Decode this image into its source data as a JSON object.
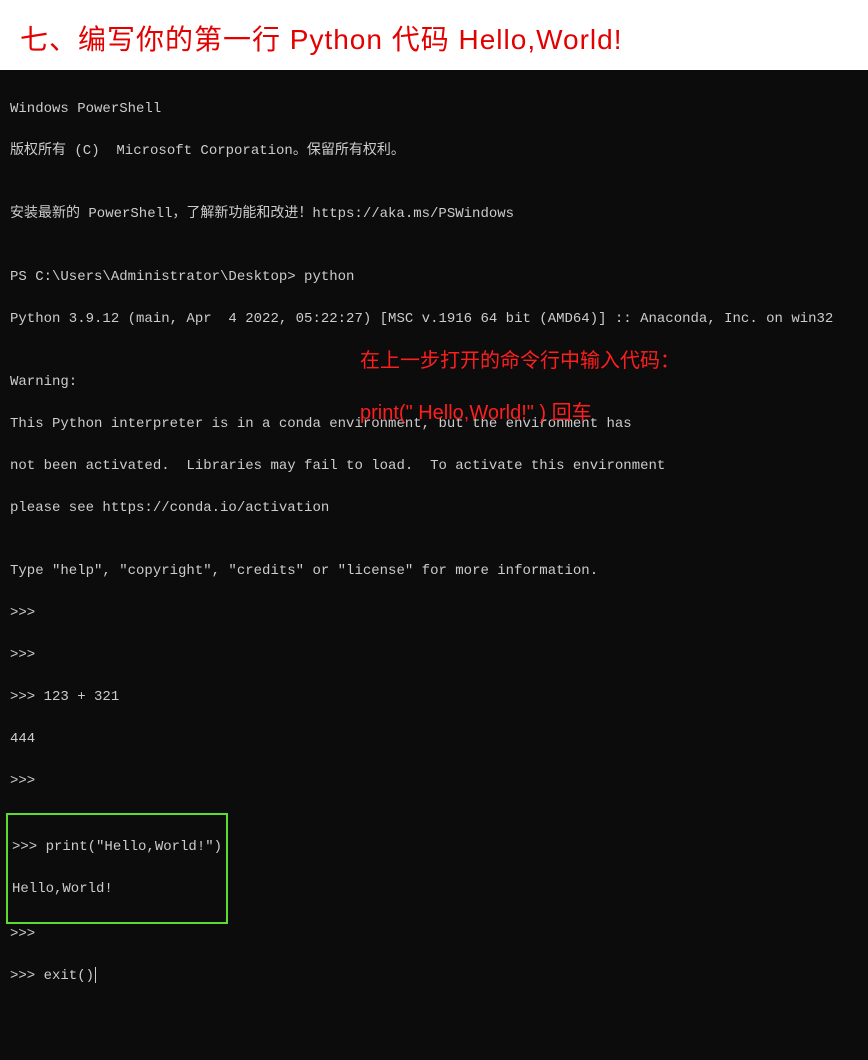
{
  "header": {
    "title": "七、编写你的第一行 Python 代码 Hello,World!"
  },
  "terminal": {
    "lines": {
      "l1": "Windows PowerShell",
      "l2": "版权所有 (C)  Microsoft Corporation。保留所有权利。",
      "l3": "",
      "l4": "安装最新的 PowerShell，了解新功能和改进！https://aka.ms/PSWindows",
      "l5": "",
      "l6": "PS C:\\Users\\Administrator\\Desktop> python",
      "l7": "Python 3.9.12 (main, Apr  4 2022, 05:22:27) [MSC v.1916 64 bit (AMD64)] :: Anaconda, Inc. on win32",
      "l8": "",
      "l9": "Warning:",
      "l10": "This Python interpreter is in a conda environment, but the environment has",
      "l11": "not been activated.  Libraries may fail to load.  To activate this environment",
      "l12": "please see https://conda.io/activation",
      "l13": "",
      "l14": "Type \"help\", \"copyright\", \"credits\" or \"license\" for more information.",
      "l15": ">>>",
      "l16": ">>>",
      "l17": ">>> 123 + 321",
      "l18": "444",
      "l19": ">>>",
      "hl1": ">>> print(\"Hello,World!\")",
      "hl2": "Hello,World!",
      "l20": ">>>",
      "l21": ">>> exit()"
    }
  },
  "annotation": {
    "line1": "在上一步打开的命令行中输入代码：",
    "line2": "print(\"  Hello,World!\"  ) 回车"
  }
}
